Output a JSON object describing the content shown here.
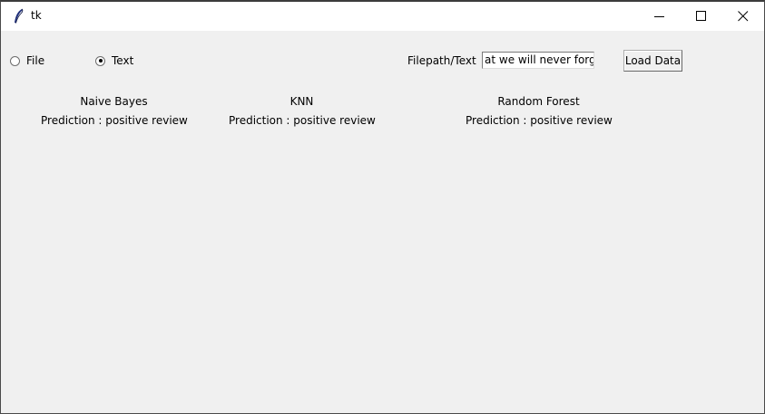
{
  "window": {
    "title": "tk",
    "icon": "tk-feather-icon",
    "controls": [
      "minimize-icon",
      "maximize-icon",
      "close-icon"
    ]
  },
  "input_mode": {
    "options": [
      {
        "label": "File",
        "checked": false
      },
      {
        "label": "Text",
        "checked": true
      }
    ]
  },
  "filepath": {
    "label": "Filepath/Text",
    "value": "at we will never forget."
  },
  "load_button": {
    "label": "Load Data"
  },
  "models": [
    {
      "name": "Naive Bayes",
      "prediction": "Prediction : positive review"
    },
    {
      "name": "KNN",
      "prediction": "Prediction : positive review"
    },
    {
      "name": "Random Forest",
      "prediction": "Prediction : positive review"
    }
  ]
}
